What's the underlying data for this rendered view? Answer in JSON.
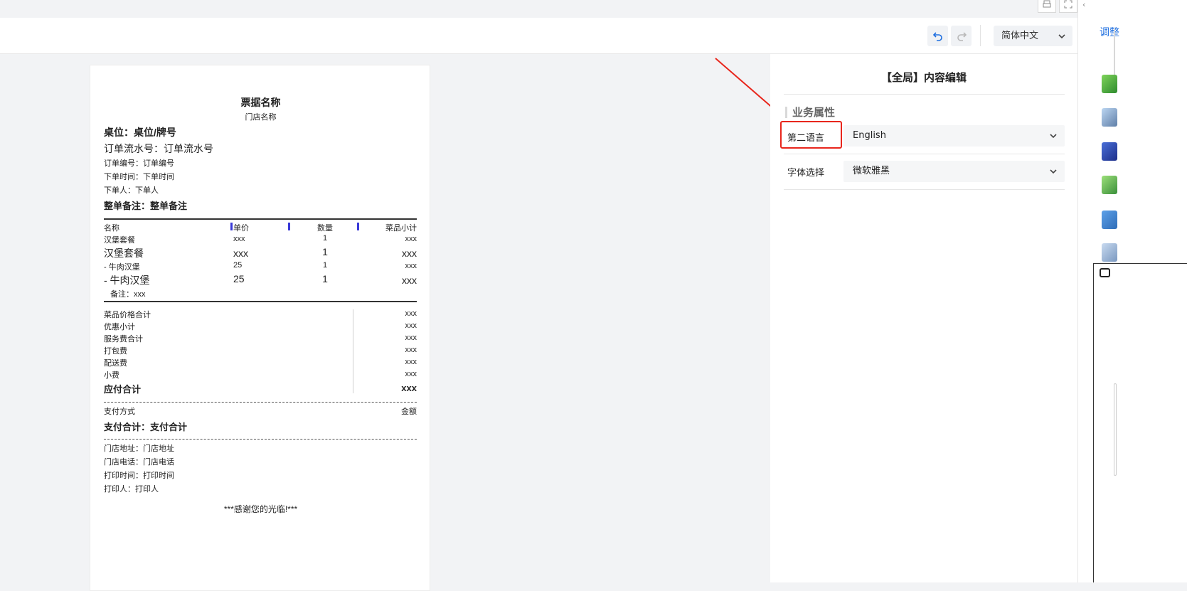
{
  "window": {
    "print_icon": "printer-icon",
    "expand_icon": "expand-icon"
  },
  "toolbar": {
    "undo_icon": "undo-icon",
    "redo_icon": "redo-icon",
    "language_select": {
      "value": "简体中文",
      "icon": "chevron-down-icon"
    }
  },
  "receipt": {
    "title": "票据名称",
    "store_name": "门店名称",
    "table_label": "桌位：桌位/牌号",
    "order_serial": "订单流水号：订单流水号",
    "order_no": "订单编号：订单编号",
    "order_time": "下单时间：下单时间",
    "orderer": "下单人：下单人",
    "order_note": "整单备注：整单备注",
    "columns": {
      "name": "名称",
      "price": "单价",
      "qty": "数量",
      "subtotal": "菜品小计"
    },
    "items": [
      {
        "name": "汉堡套餐",
        "price": "xxx",
        "qty": "1",
        "subtotal": "xxx"
      },
      {
        "name": "汉堡套餐",
        "price": "xxx",
        "qty": "1",
        "subtotal": "xxx"
      },
      {
        "name": "- 牛肉汉堡",
        "price": "25",
        "qty": "1",
        "subtotal": "xxx"
      },
      {
        "name": "- 牛肉汉堡",
        "price": "25",
        "qty": "1",
        "subtotal": "xxx"
      }
    ],
    "item_note": "备注：xxx",
    "summary": [
      {
        "label": "菜品价格合计",
        "value": "xxx"
      },
      {
        "label": "优惠小计",
        "value": "xxx"
      },
      {
        "label": "服务费合计",
        "value": "xxx"
      },
      {
        "label": "打包费",
        "value": "xxx"
      },
      {
        "label": "配送费",
        "value": "xxx"
      },
      {
        "label": "小费",
        "value": "xxx"
      }
    ],
    "total": {
      "label": "应付合计",
      "value": "xxx"
    },
    "payment": {
      "method_label": "支付方式",
      "amount_label": "金额",
      "paid_total": "支付合计：支付合计"
    },
    "footer": {
      "address": "门店地址：门店地址",
      "phone": "门店电话：门店电话",
      "print_time": "打印时间：打印时间",
      "printer": "打印人：打印人",
      "thanks": "***感谢您的光临!***"
    }
  },
  "panel": {
    "title": "【全局】内容编辑",
    "section": "业务属性",
    "fields": [
      {
        "label": "第二语言",
        "value": "English"
      },
      {
        "label": "字体选择",
        "value": "微软雅黑"
      }
    ]
  },
  "sidebar": {
    "partial_text": "调整",
    "icons": [
      "green-app-icon",
      "building-icon",
      "flag-icon",
      "shield-app-icon",
      "monitor-check-icon",
      "calculator-icon"
    ]
  },
  "colors": {
    "accent": "#1f6fe0",
    "highlight": "#e8261c",
    "column_marker": "#3a3ad8"
  }
}
